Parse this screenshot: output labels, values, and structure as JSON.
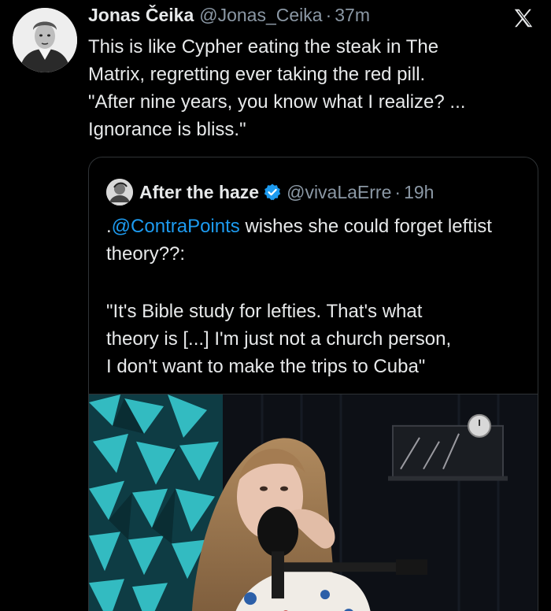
{
  "tweet": {
    "author_name": "Jonas Čeika",
    "author_handle": "@Jonas_Ceika",
    "separator": "·",
    "time": "37m",
    "text": "This is like Cypher eating the steak in The\nMatrix, regretting ever taking the red pill.\n\"After nine years, you know what I realize? ...\nIgnorance is bliss.\""
  },
  "quote": {
    "author_name": "After the haze",
    "author_handle": "@vivaLaErre",
    "separator": "·",
    "time": "19h",
    "text_prefix": ".",
    "mention": "@ContraPoints",
    "text_rest": " wishes she could forget leftist theory??:",
    "quote_text": "\"It's Bible study for lefties. That's what\ntheory is [...] I'm just not a church person,\nI don't want to make the trips to Cuba\""
  },
  "icons": {
    "close": "x-logo-icon",
    "verified": "verified-badge-icon"
  },
  "colors": {
    "background": "#000000",
    "text": "#e7e9ea",
    "secondary": "#8b98a5",
    "link": "#1d9bf0",
    "border": "#2f3336"
  }
}
